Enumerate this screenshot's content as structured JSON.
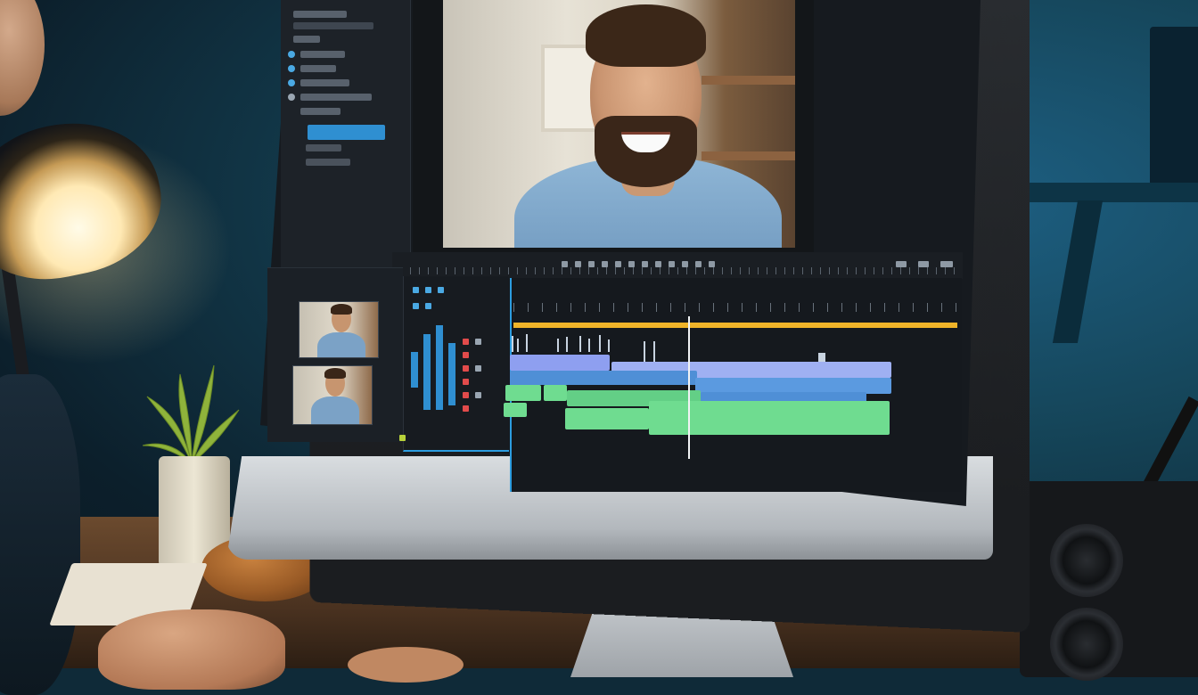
{
  "scene": {
    "description_labels": {
      "left_panel_title": "",
      "left_panel_selected": "",
      "left_panel_footer": "",
      "viewer_tab": "",
      "viewer_status": "",
      "bin_header": "",
      "timeline_labels": ""
    }
  },
  "colors": {
    "accent_blue": "#2f8fd1",
    "timeline_yellow": "#f0b429",
    "clip_purple": "#8e9ff0",
    "clip_blue": "#4f8fd6",
    "clip_green": "#6fdc90"
  }
}
